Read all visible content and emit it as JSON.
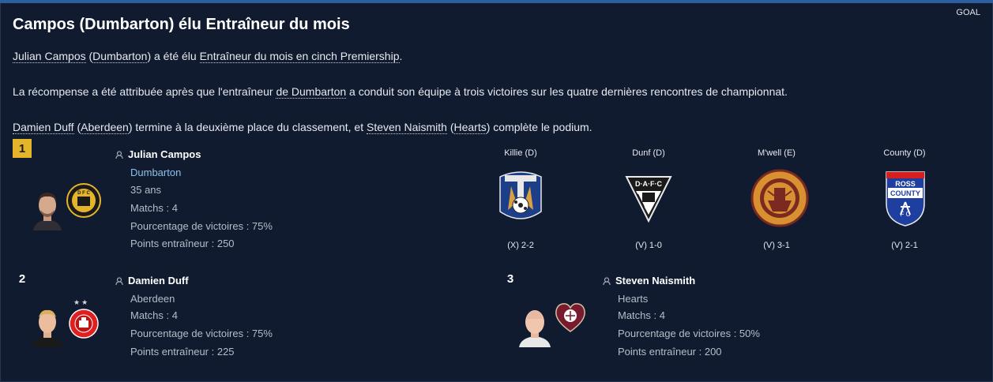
{
  "header": {
    "source": "GOAL",
    "title": "Campos (Dumbarton) élu Entraîneur du mois"
  },
  "body": {
    "line1": {
      "manager": "Julian Campos",
      "open": " (",
      "club": "Dumbarton",
      "close": ") a été élu ",
      "award": "Entraîneur du mois en cinch Premiership",
      "end": "."
    },
    "line2": {
      "before": "La récompense a été attribuée après que l'entraîneur ",
      "link": "de Dumbarton",
      "after": " a conduit son équipe à trois victoires sur les quatre dernières rencontres de championnat."
    },
    "line3": {
      "m2": "Damien Duff",
      "p1": " (",
      "c2": "Aberdeen",
      "p2": ") termine à la deuxième place du classement, et ",
      "m3": "Steven Naismith",
      "p3": " (",
      "c3": "Hearts",
      "p4": ") complète le podium."
    }
  },
  "podium": [
    {
      "rank": "1",
      "name": "Julian Campos",
      "club": "Dumbarton",
      "age": "35 ans",
      "matches": "Matchs : 4",
      "win_pct": "Pourcentage de victoires : 75%",
      "points": "Points entraîneur : 250"
    },
    {
      "rank": "2",
      "name": "Damien Duff",
      "club": "Aberdeen",
      "matches": "Matchs : 4",
      "win_pct": "Pourcentage de victoires : 75%",
      "points": "Points entraîneur : 225",
      "stars": "★★"
    },
    {
      "rank": "3",
      "name": "Steven Naismith",
      "club": "Hearts",
      "matches": "Matchs : 4",
      "win_pct": "Pourcentage de victoires : 50%",
      "points": "Points entraîneur : 200"
    }
  ],
  "results": [
    {
      "opponent": "Killie (D)",
      "score": "(X) 2-2",
      "crest": "kilmarnock-crest"
    },
    {
      "opponent": "Dunf (D)",
      "score": "(V) 1-0",
      "crest": "dunfermline-crest"
    },
    {
      "opponent": "M'well (E)",
      "score": "(V) 3-1",
      "crest": "motherwell-crest"
    },
    {
      "opponent": "County (D)",
      "score": "(V) 2-1",
      "crest": "ross-county-crest"
    }
  ],
  "crest_text": {
    "dunf": "D·A·F·C",
    "ross": "ROSS",
    "county": "COUNTY",
    "fc": "F  C",
    "dumbarton": "D F C"
  },
  "colors": {
    "accent_gold": "#e4b52a",
    "link_blue": "#8fc0ea",
    "background": "#111b30"
  }
}
